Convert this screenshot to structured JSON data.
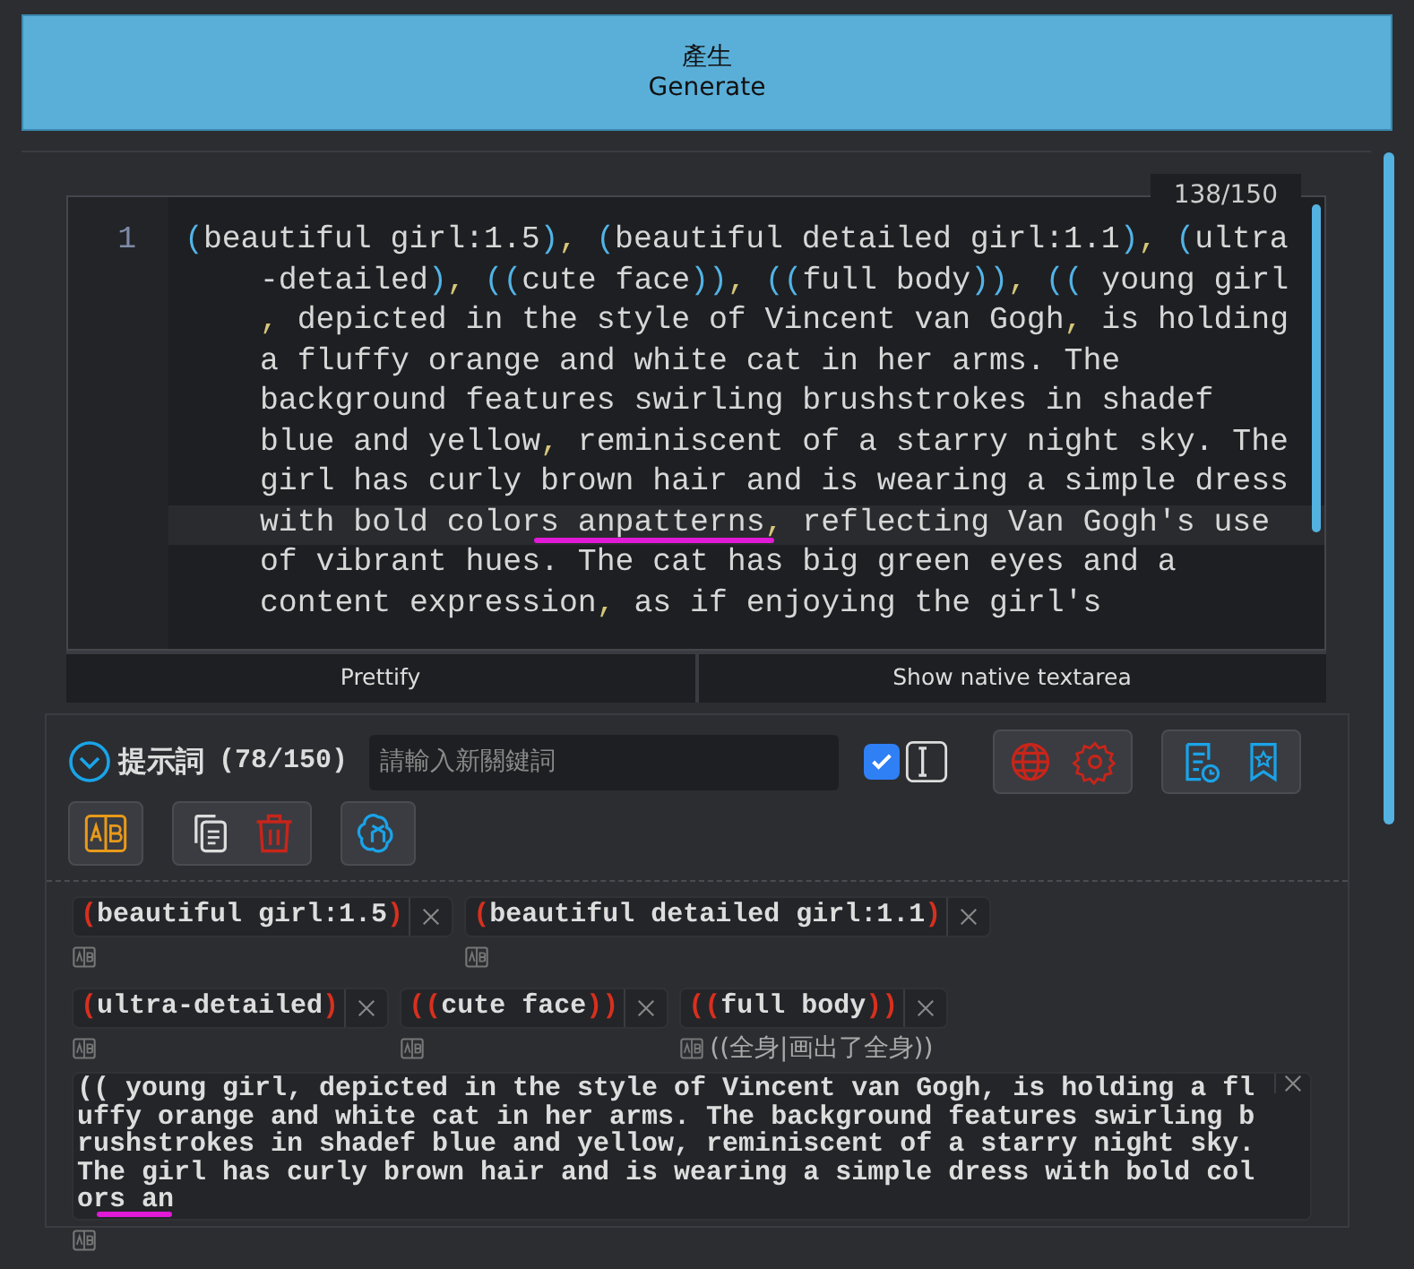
{
  "generate_button": {
    "label_zh": "產生",
    "label_en": "Generate"
  },
  "editor": {
    "counter": "138/150",
    "line_number": "1",
    "lines": [
      {
        "text": "(beautiful girl:1.5), (beautiful detailed girl:1.1), (ultra",
        "active": false
      },
      {
        "text": "-detailed), ((cute face)), ((full body)), (( young girl",
        "active": false
      },
      {
        "text": ", depicted in the style of Vincent van Gogh, is holding",
        "active": false
      },
      {
        "text": "a fluffy orange and white cat in her arms. The",
        "active": false
      },
      {
        "text": "background features swirling brushstrokes in shadef",
        "active": false
      },
      {
        "text": "blue and yellow, reminiscent of a starry night sky. The",
        "active": false
      },
      {
        "text": "girl has curly brown hair and is wearing a simple dress",
        "active": false
      },
      {
        "text": "with bold colors anpatterns, reflecting Van Gogh's use",
        "active": true
      },
      {
        "text": "of vibrant hues. The cat has big green eyes and a",
        "active": false
      },
      {
        "text": "content expression, as if enjoying the girl's",
        "active": false
      }
    ],
    "buttons": [
      "Prettify",
      "Show native textarea"
    ]
  },
  "prompt": {
    "expanded": true,
    "title": "提示詞",
    "count": "(78/150)",
    "placeholder": "請輸入新關鍵詞",
    "checkbox_checked": true
  },
  "tags": [
    {
      "kind": "tag",
      "open": "(",
      "text": "beautiful girl:1.5",
      "close": ")"
    },
    {
      "kind": "tag",
      "open": "(",
      "text": "beautiful detailed girl:1.1",
      "close": ")"
    },
    {
      "kind": "break"
    },
    {
      "kind": "tag",
      "open": "(",
      "text": "ultra-detailed",
      "close": ")"
    },
    {
      "kind": "tag",
      "open": "((",
      "text": "cute face",
      "close": "))"
    },
    {
      "kind": "tag",
      "open": "((",
      "text": "full body",
      "close": "))",
      "translation": "((全身|画出了全身))"
    },
    {
      "kind": "editing",
      "text": "(( young girl, depicted in the style of Vincent van Gogh, is holding a fluffy orange and white cat in her arms. The background features swirling brushstrokes in shadef blue and yellow, reminiscent of a starry night sky. The girl has curly brown hair and is wearing a simple dress with bold colors an"
    }
  ]
}
